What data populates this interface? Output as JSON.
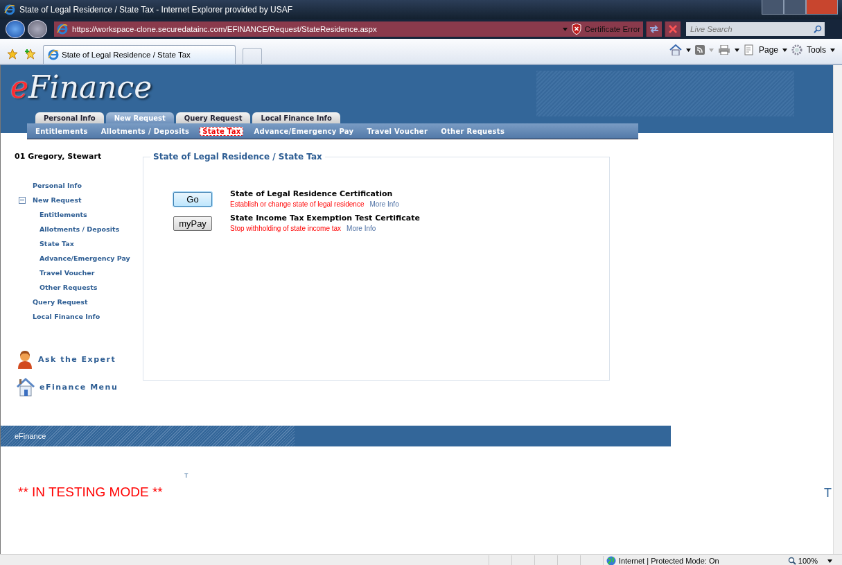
{
  "window": {
    "title": "State of Legal Residence / State Tax - Internet Explorer provided by USAF"
  },
  "address_bar": {
    "url": "https://workspace-clone.securedatainc.com/EFINANCE/Request/StateResidence.aspx",
    "security": "Certificate Error"
  },
  "search": {
    "placeholder": "Live Search"
  },
  "browser_tabs": [
    {
      "label": "State of Legal Residence / State Tax",
      "selected": true
    }
  ],
  "command_bar": {
    "page": "Page",
    "tools": "Tools"
  },
  "site": {
    "logo_mark": "e",
    "logo_text": "Finance"
  },
  "main_tabs": [
    {
      "label": "Personal Info",
      "selected": false
    },
    {
      "label": "New Request",
      "selected": true
    },
    {
      "label": "Query Request",
      "selected": false
    },
    {
      "label": "Local Finance Info",
      "selected": false
    }
  ],
  "sub_nav": [
    {
      "label": "Entitlements",
      "selected": false
    },
    {
      "label": "Allotments / Deposits",
      "selected": false
    },
    {
      "label": "State Tax",
      "selected": true
    },
    {
      "label": "Advance/Emergency Pay",
      "selected": false
    },
    {
      "label": "Travel Voucher",
      "selected": false
    },
    {
      "label": "Other Requests",
      "selected": false
    }
  ],
  "user": "01 Gregory, Stewart",
  "side_nav": [
    {
      "label": "Personal Info"
    },
    {
      "label": "New Request",
      "expanded": true,
      "children": [
        {
          "label": "Entitlements"
        },
        {
          "label": "Allotments / Deposits"
        },
        {
          "label": "State Tax"
        },
        {
          "label": "Advance/Emergency Pay"
        },
        {
          "label": "Travel Voucher"
        },
        {
          "label": "Other Requests"
        }
      ]
    },
    {
      "label": "Query Request"
    },
    {
      "label": "Local Finance Info"
    }
  ],
  "panel": {
    "title": "State of Legal Residence / State Tax",
    "items": [
      {
        "button": "Go",
        "focused": true,
        "title": "State of Legal Residence Certification",
        "description": "Establish or change state of legal residence",
        "link": "More Info"
      },
      {
        "button": "myPay",
        "focused": false,
        "title": "State Income Tax Exemption Test Certificate",
        "description": "Stop withholding of state income tax",
        "link": "More Info"
      }
    ]
  },
  "quick_links": [
    {
      "kind": "expert",
      "label": "Ask the Expert"
    },
    {
      "kind": "home",
      "label": "eFinance Menu"
    }
  ],
  "footer": {
    "label": "eFinance"
  },
  "testing": {
    "marker": "T",
    "message": "** IN TESTING MODE **",
    "edge_marker": "T"
  },
  "status_bar": {
    "zone": "Internet | Protected Mode: On",
    "zoom": "100%"
  }
}
